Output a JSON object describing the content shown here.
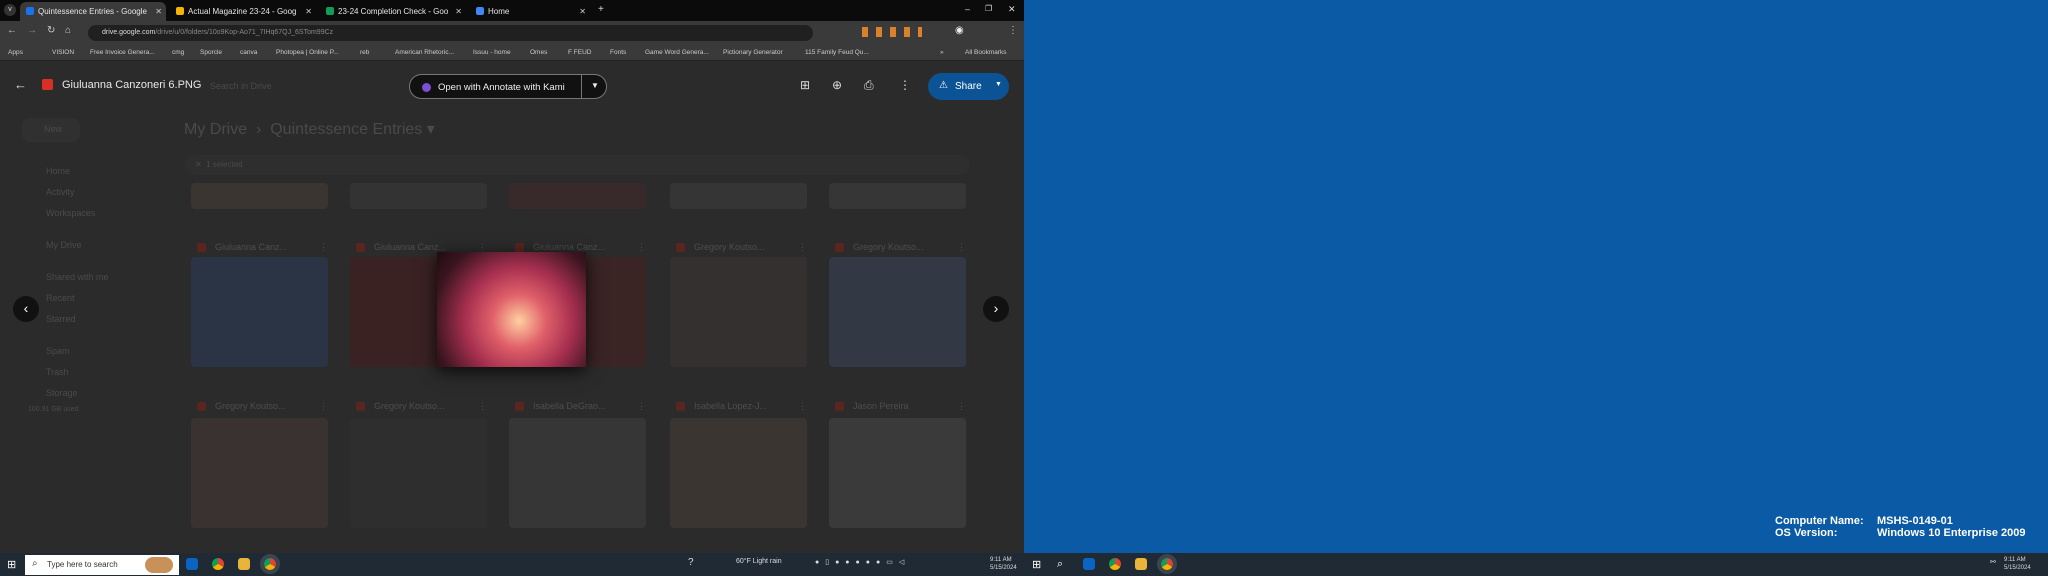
{
  "browser": {
    "tabs": [
      {
        "label": "Quintessence Entries - Google",
        "color": "#1a73e8",
        "active": true
      },
      {
        "label": "Actual Magazine 23-24 - Goog",
        "color": "#f4b400"
      },
      {
        "label": "23-24 Completion Check - Goo",
        "color": "#0f9d58"
      },
      {
        "label": "Home",
        "color": "#4285f4"
      }
    ],
    "url_host": "drive.google.com",
    "url_path": "/drive/u/0/folders/10o9Kop-Ao71_7IHq67QJ_6STom99Cz",
    "bookmarks": [
      "Apps",
      "VISION",
      "Free Invoice Genera...",
      "cmg",
      "Sporcle",
      "canva",
      "Photopea | Online P...",
      "reb",
      "American Rhetoric...",
      "Issuu - home",
      "Omes",
      "F FEUD",
      "Fonts",
      "Game Word Genera...",
      "Pictionary Generator",
      "115 Family Feud Qu..."
    ],
    "all_bookmarks": "All Bookmarks"
  },
  "viewer": {
    "file_name": "Giuluanna Canzoneri 6.PNG",
    "search_placeholder": "Search in Drive",
    "open_with": "Open with Annotate with Kami",
    "share": "Share"
  },
  "drive": {
    "new": "New",
    "breadcrumb": [
      "My Drive",
      "Quintessence Entries"
    ],
    "selection": "1 selected",
    "sidebar": [
      "Home",
      "Activity",
      "Workspaces",
      "My Drive",
      "Shared with me",
      "Recent",
      "Starred",
      "Spam",
      "Trash",
      "Storage"
    ],
    "storage": "100.91 GB used",
    "row2": [
      "Giuluanna Canz...",
      "Giuluanna Canz...",
      "Giuluanna Canz...",
      "Gregory Koutso...",
      "Gregory Koutso..."
    ],
    "row3": [
      "Gregory Koutso...",
      "Gregory Koutso...",
      "Isabella DeGrao...",
      "Isabella Lopez-J...",
      "Jason Pereira"
    ]
  },
  "taskbar": {
    "search_placeholder": "Type here to search",
    "weather": "60°F  Light rain",
    "time": "9:11 AM",
    "date": "5/15/2024"
  },
  "desktop": {
    "computer_name_label": "Computer Name:",
    "computer_name": "MSHS-0149-01",
    "os_label": "OS Version:",
    "os": "Windows 10 Enterprise 2009"
  }
}
